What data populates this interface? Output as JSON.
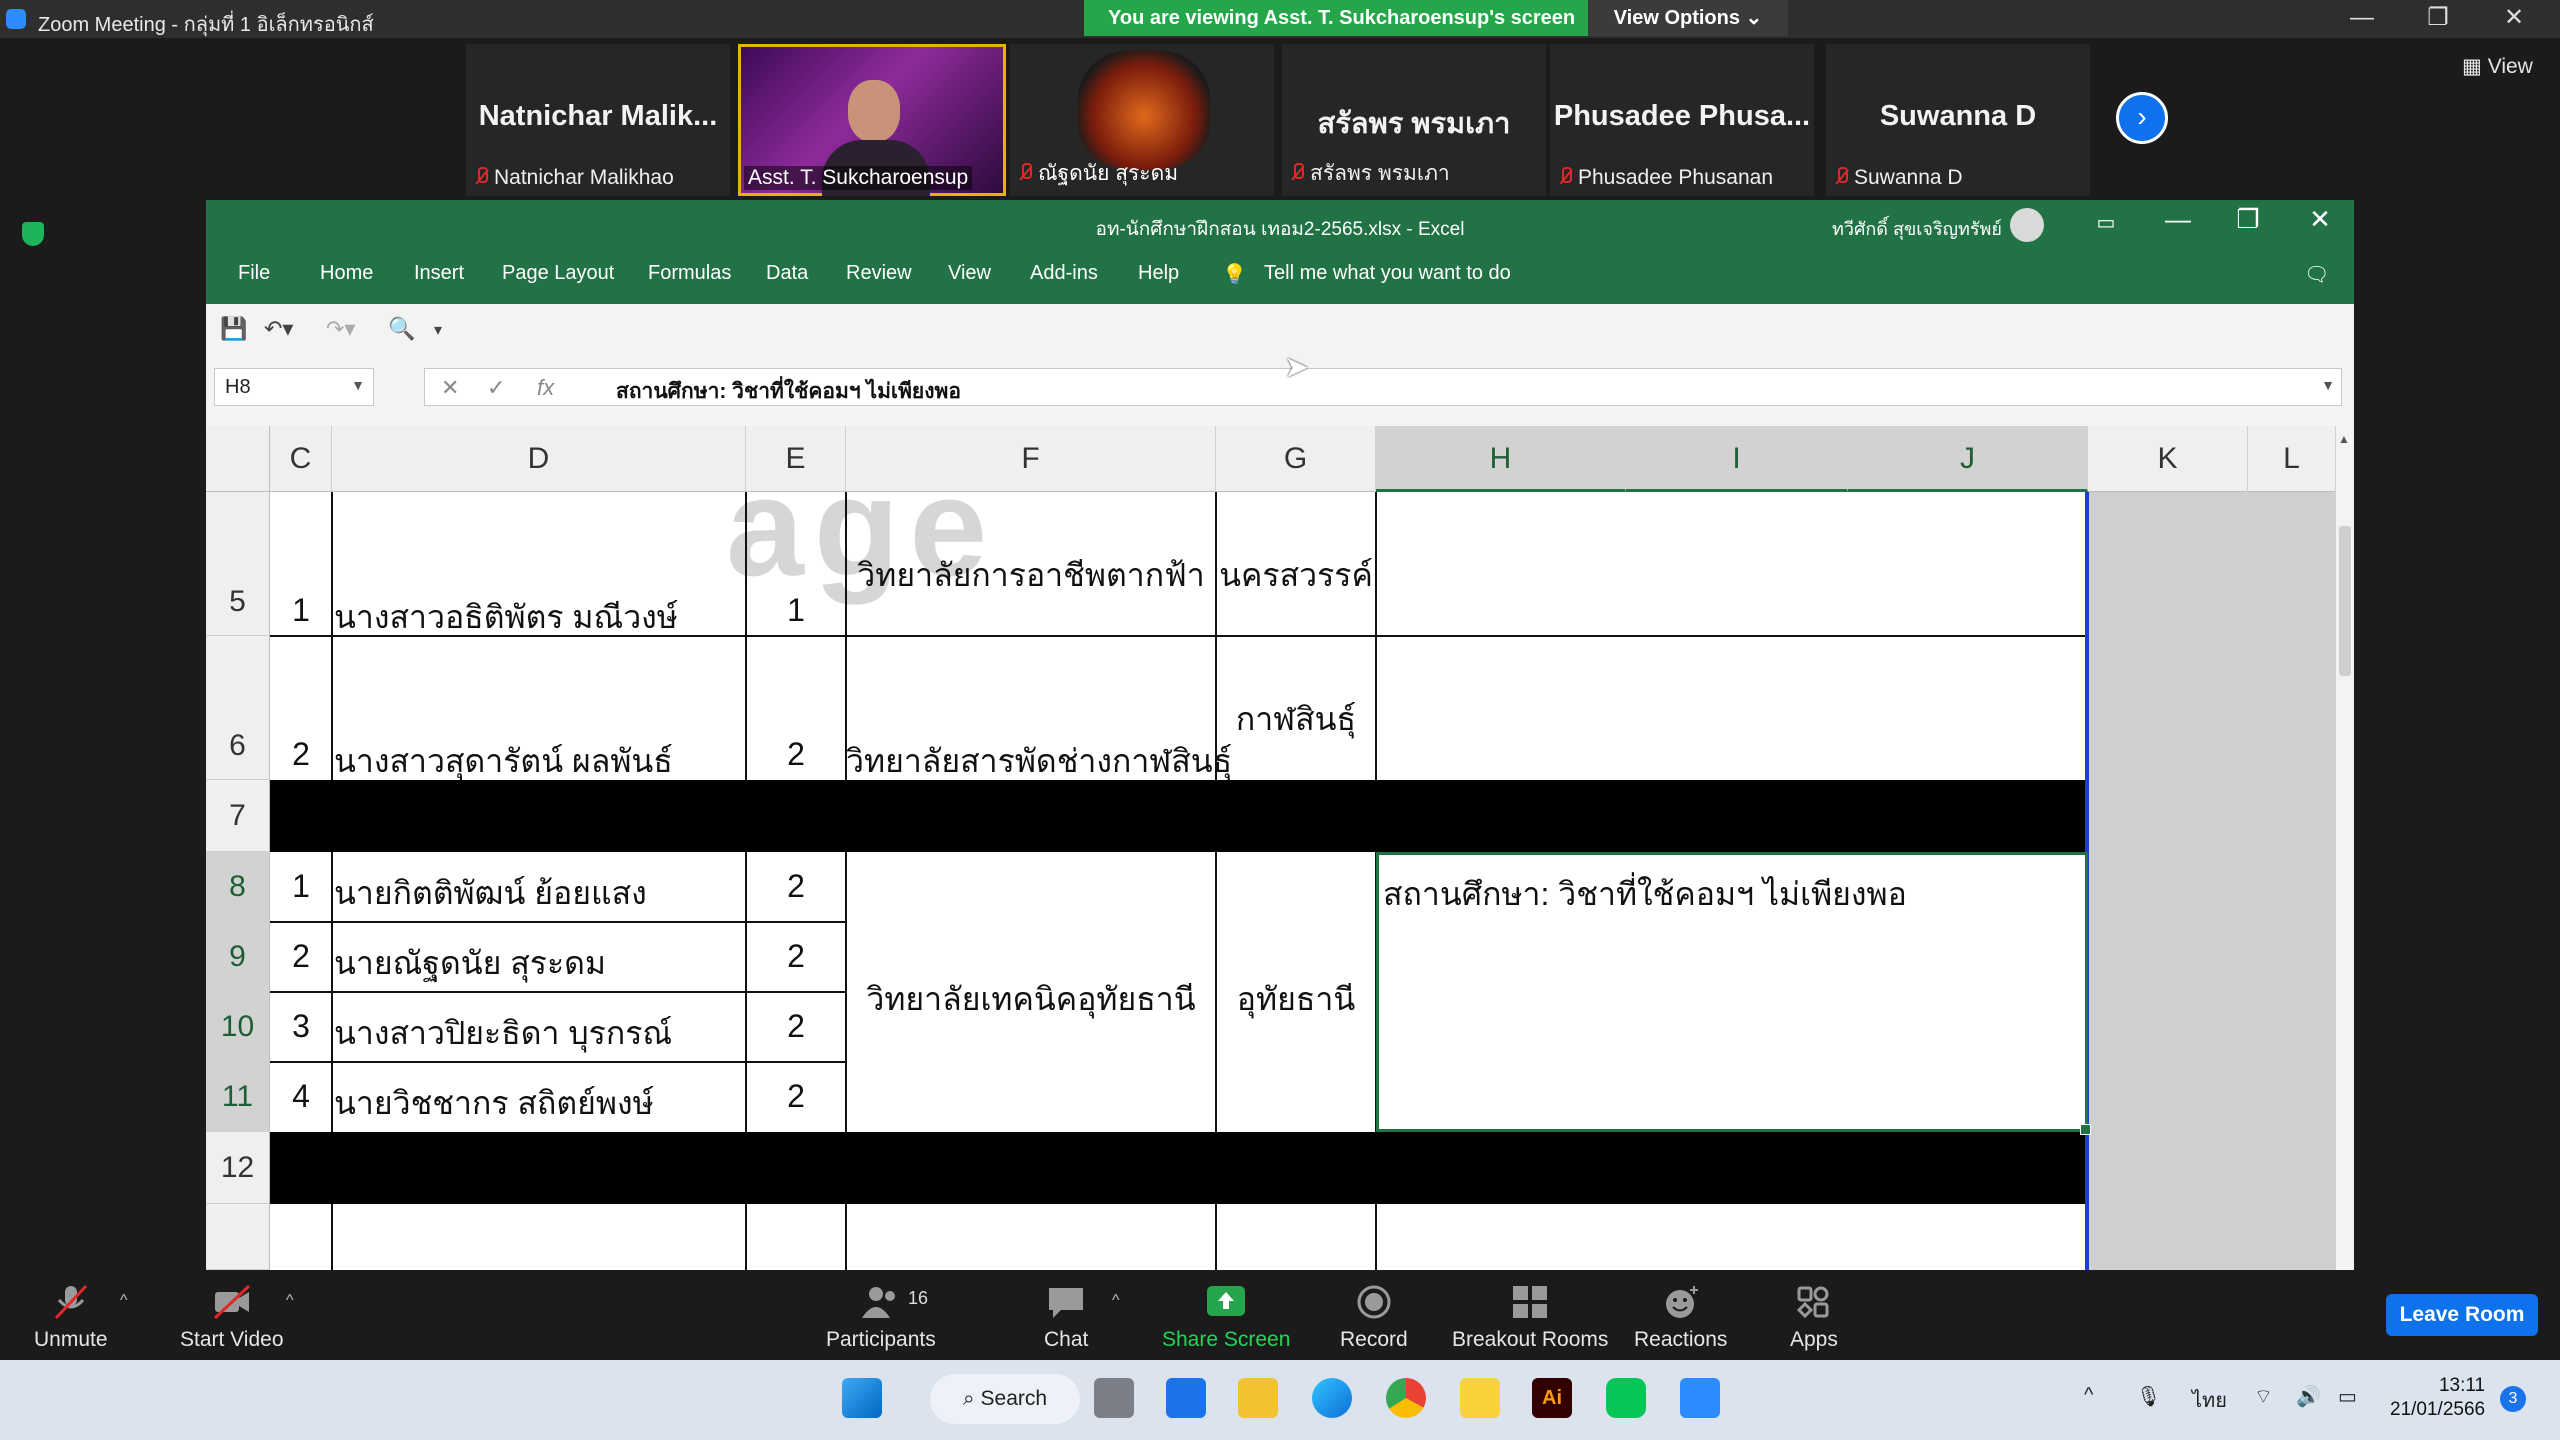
{
  "zoom": {
    "window_title": "Zoom Meeting - กลุ่มที่ 1 อิเล็กทรอนิกส์",
    "share_banner": "You are viewing Asst. T. Sukcharoensup's screen",
    "view_options": "View Options ⌄",
    "view_label": "View",
    "participants_strip": [
      {
        "big_name": "Natnichar  Malik...",
        "small_name": "Natnichar Malikhao"
      },
      {
        "big_name": "",
        "small_name": "Asst. T. Sukcharoensup"
      },
      {
        "big_name": "",
        "small_name": "ณัฐดนัย สุระดม"
      },
      {
        "big_name": "สรัลพร พรมเภา",
        "small_name": "สรัลพร พรมเภา"
      },
      {
        "big_name": "Phusadee  Phusa...",
        "small_name": "Phusadee Phusanan"
      },
      {
        "big_name": "Suwanna D",
        "small_name": "Suwanna D"
      }
    ],
    "toolbar": {
      "unmute": "Unmute",
      "start_video": "Start Video",
      "participants": "Participants",
      "participants_count": "16",
      "chat": "Chat",
      "share_screen": "Share Screen",
      "record": "Record",
      "breakout_rooms": "Breakout Rooms",
      "reactions": "Reactions",
      "apps": "Apps",
      "leave_room": "Leave Room"
    }
  },
  "excel": {
    "window_title": "อท-นักศึกษาฝึกสอน เทอม2-2565.xlsx  -  Excel",
    "user_name": "ทวีศักดิ์ สุขเจริญทรัพย์",
    "menu": [
      "File",
      "Home",
      "Insert",
      "Page Layout",
      "Formulas",
      "Data",
      "Review",
      "View",
      "Add-ins",
      "Help"
    ],
    "tell_me": "Tell me what you want to do",
    "name_box": "H8",
    "formula": "สถานศึกษา: วิชาที่ใช้คอมฯ ไม่เพียงพอ",
    "columns": [
      "C",
      "D",
      "E",
      "F",
      "G",
      "H",
      "I",
      "J",
      "K",
      "L"
    ],
    "rows": {
      "r5": {
        "num": "5",
        "c": "1",
        "d": "นางสาวอธิติพัตร มณีวงษ์",
        "e": "1",
        "f": "วิทยาลัยการอาชีพตากฟ้า",
        "g": "นครสวรรค์"
      },
      "r6": {
        "num": "6",
        "c": "2",
        "d": "นางสาวสุดารัตน์ ผลพันธ์",
        "e": "2",
        "f": "วิทยาลัยสารพัดช่างกาฬสินธุ์",
        "g": "กาฬสินธุ์"
      },
      "r7": {
        "num": "7"
      },
      "r8": {
        "num": "8",
        "c": "1",
        "d": "นายกิตติพัฒน์ ย้อยแสง",
        "e": "2"
      },
      "r9": {
        "num": "9",
        "c": "2",
        "d": "นายณัฐดนัย สุระดม",
        "e": "2"
      },
      "r10": {
        "num": "10",
        "c": "3",
        "d": "นางสาวปิยะธิดา บุรกรณ์",
        "e": "2"
      },
      "r11": {
        "num": "11",
        "c": "4",
        "d": "นายวิชชากร สถิตย์พงษ์",
        "e": "2"
      },
      "r12": {
        "num": "12"
      },
      "merged_f8": "วิทยาลัยเทคนิคอุทัยธานี",
      "merged_g8": "อุทัยธานี",
      "merged_h8": "สถานศึกษา: วิชาที่ใช้คอมฯ ไม่เพียงพอ"
    }
  },
  "taskbar": {
    "search": "Search",
    "lang": "ไทย",
    "time": "13:11",
    "date": "21/01/2566",
    "notifications": "3"
  },
  "colors": {
    "excel_green": "#217346",
    "zoom_blue": "#0e72ed",
    "share_green": "#26a64a"
  }
}
